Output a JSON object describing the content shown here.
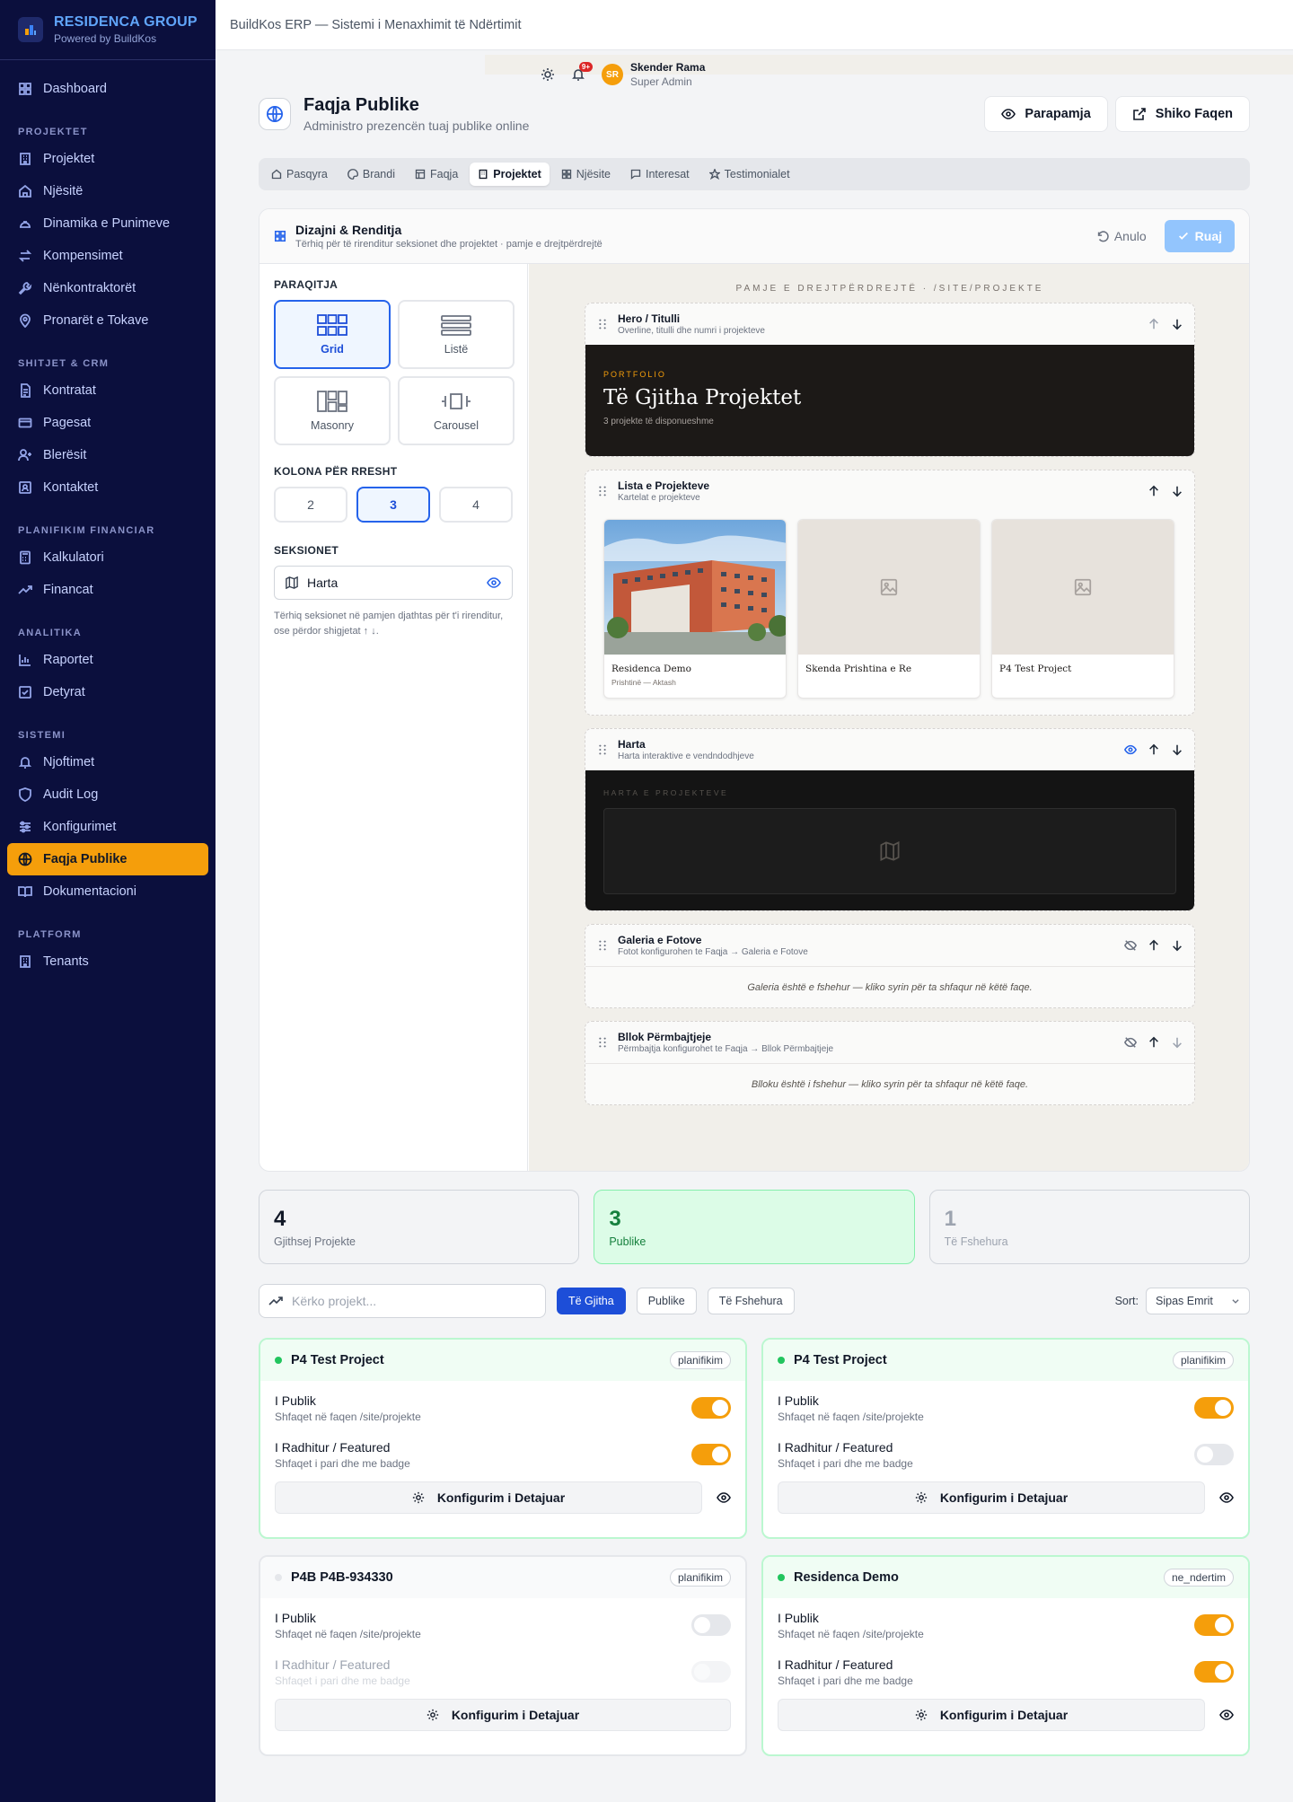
{
  "sidebar": {
    "brand_title": "RESIDENCA GROUP",
    "brand_sub": "Powered by BuildKos",
    "dashboard": "Dashboard",
    "sections": [
      {
        "title": "PROJEKTET",
        "items": [
          "Projektet",
          "Njësitë",
          "Dinamika e Punimeve",
          "Kompensimet",
          "Nënkontraktorët",
          "Pronarët e Tokave"
        ]
      },
      {
        "title": "SHITJET & CRM",
        "items": [
          "Kontratat",
          "Pagesat",
          "Blerësit",
          "Kontaktet"
        ]
      },
      {
        "title": "PLANIFIKIM FINANCIAR",
        "items": [
          "Kalkulatori",
          "Financat"
        ]
      },
      {
        "title": "ANALITIKA",
        "items": [
          "Raportet",
          "Detyrat"
        ]
      },
      {
        "title": "SISTEMI",
        "items": [
          "Njoftimet",
          "Audit Log",
          "Konfigurimet",
          "Faqja Publike",
          "Dokumentacioni"
        ]
      },
      {
        "title": "PLATFORM",
        "items": [
          "Tenants"
        ]
      }
    ]
  },
  "topbar": {
    "title": "BuildKos ERP — Sistemi i Menaxhimit të Ndërtimit",
    "badge": "9+",
    "initials": "SR",
    "user": "Skender Rama",
    "role": "Super Admin"
  },
  "page": {
    "title": "Faqja Publike",
    "subtitle": "Administro prezencën tuaj publike online",
    "preview_btn": "Parapamja",
    "view_btn": "Shiko Faqen"
  },
  "tabs": [
    "Pasqyra",
    "Brandi",
    "Faqja",
    "Projektet",
    "Njësite",
    "Interesat",
    "Testimonialet"
  ],
  "designer": {
    "title": "Dizajni & Renditja",
    "subtitle": "Tërhiq për të rirenditur seksionet dhe projektet · pamje e drejtpërdrejtë",
    "undo": "Anulo",
    "save": "Ruaj",
    "layout_label": "PARAQITJA",
    "layouts": [
      "Grid",
      "Listë",
      "Masonry",
      "Carousel"
    ],
    "cols_label": "KOLONA PËR RRESHT",
    "cols": [
      "2",
      "3",
      "4"
    ],
    "sections_label": "SEKSIONET",
    "section_item": "Harta",
    "hint": "Tërhiq seksionet në pamjen djathtas për t'i rirenditur, ose përdor shigjetat ↑ ↓.",
    "preview_caption": "PAMJE E DREJTPËRDREJTË · /SITE/PROJEKTE",
    "blocks": [
      {
        "title": "Hero / Titulli",
        "sub": "Overline, titulli dhe numri i projekteve"
      },
      {
        "title": "Lista e Projekteve",
        "sub": "Kartelat e projekteve"
      },
      {
        "title": "Harta",
        "sub": "Harta interaktive e vendndodhjeve"
      },
      {
        "title": "Galeria e Fotove",
        "sub": "Fotot konfigurohen te Faqja → Galeria e Fotove",
        "note": "Galeria është e fshehur — kliko syrin për ta shfaqur në këtë faqe."
      },
      {
        "title": "Bllok Përmbajtjeje",
        "sub": "Përmbajtja konfigurohet te Faqja → Bllok Përmbajtjeje",
        "note": "Blloku është i fshehur — kliko syrin për ta shfaqur në këtë faqe."
      }
    ],
    "hero": {
      "overline": "PORTFOLIO",
      "title": "Të Gjitha Projektet",
      "count": "3 projekte të disponueshme"
    },
    "cards": [
      {
        "name": "Residenca Demo",
        "loc": "Prishtinë — Aktash"
      },
      {
        "name": "Skenda Prishtina e Re",
        "loc": ""
      },
      {
        "name": "P4 Test Project",
        "loc": ""
      }
    ],
    "map_caption": "HARTA E PROJEKTEVE"
  },
  "stats": [
    {
      "n": "4",
      "l": "Gjithsej Projekte"
    },
    {
      "n": "3",
      "l": "Publike"
    },
    {
      "n": "1",
      "l": "Të Fshehura"
    }
  ],
  "filters": {
    "search_placeholder": "Kërko projekt...",
    "chips": [
      "Të Gjitha",
      "Publike",
      "Të Fshehura"
    ],
    "sort_label": "Sort:",
    "sort_value": "Sipas Emrit"
  },
  "projects_labels": {
    "public": "I Publik",
    "public_sub": "Shfaqet në faqen /site/projekte",
    "featured": "I Radhitur / Featured",
    "featured_sub": "Shfaqet i pari dhe me badge",
    "config": "Konfigurim i Detajuar"
  },
  "projects": [
    {
      "name": "P4 Test Project",
      "tag": "planifikim"
    },
    {
      "name": "P4 Test Project",
      "tag": "planifikim"
    },
    {
      "name": "P4B P4B-934330",
      "tag": "planifikim"
    },
    {
      "name": "Residenca Demo",
      "tag": "ne_ndertim"
    }
  ],
  "colors": {
    "sidebar_bg": "#0b0f3d",
    "accent": "#f59e0b",
    "primary": "#2563eb"
  }
}
